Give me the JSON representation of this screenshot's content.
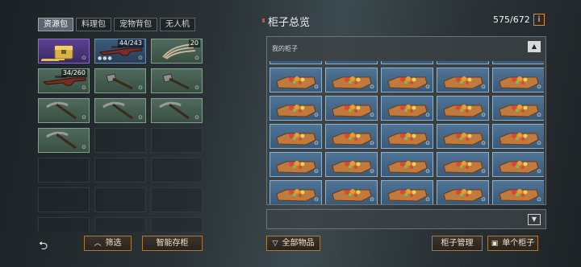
{
  "tabs": [
    {
      "label": "资源包",
      "active": true
    },
    {
      "label": "料理包",
      "active": false
    },
    {
      "label": "宠物背包",
      "active": false
    },
    {
      "label": "无人机",
      "active": false
    }
  ],
  "inventory": [
    {
      "item": "golden-chest",
      "rarity": "purple",
      "count": ""
    },
    {
      "item": "rifle",
      "rarity": "blue",
      "count": "44/243"
    },
    {
      "item": "fiber-bundle",
      "rarity": "green",
      "count": "20"
    },
    {
      "item": "rifle",
      "rarity": "green",
      "count": "34/260"
    },
    {
      "item": "hatchet",
      "rarity": "green",
      "count": ""
    },
    {
      "item": "hatchet",
      "rarity": "green",
      "count": ""
    },
    {
      "item": "pickaxe",
      "rarity": "green",
      "count": ""
    },
    {
      "item": "pickaxe",
      "rarity": "green",
      "count": ""
    },
    {
      "item": "pickaxe",
      "rarity": "green",
      "count": ""
    },
    {
      "item": "pickaxe",
      "rarity": "green",
      "count": ""
    }
  ],
  "empty_slots": 11,
  "buttons": {
    "filter": "筛选",
    "smart_store": "智能存柜",
    "all_items": "全部物品",
    "cabinet_manage": "柜子管理",
    "single_cabinet": "单个柜子"
  },
  "cabinet": {
    "title": "柜子总览",
    "capacity": "575/672",
    "info_icon": "i",
    "section_label": "我的柜子",
    "slot_item": "food-box",
    "visible_rows": 5,
    "columns": 5
  },
  "colors": {
    "accent_orange": "#e08a2c",
    "button_border": "#a47b43",
    "rarity_purple": "#5c3f92",
    "rarity_blue": "#3a5a7d",
    "rarity_green": "#4f6a5c",
    "cabinet_slot": "#4f7497"
  },
  "icons": {
    "back": "back-arrow-icon",
    "filter": "chevron-up-icon",
    "all_items": "funnel-icon",
    "single_cabinet": "cabinet-icon",
    "scroll_up": "chevron-up-icon",
    "scroll_down": "chevron-down-icon"
  }
}
